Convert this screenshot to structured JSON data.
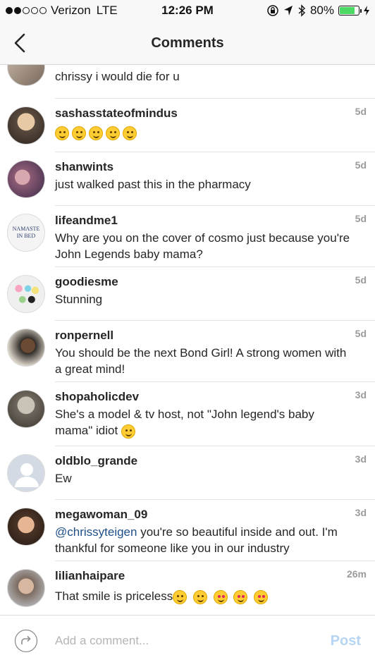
{
  "status_bar": {
    "carrier": "Verizon",
    "network": "LTE",
    "time": "12:26 PM",
    "battery": "80%",
    "battery_level": 0.8,
    "battery_color": "#4cd964"
  },
  "nav": {
    "title": "Comments",
    "back_icon": "chevron-left-icon"
  },
  "comments": [
    {
      "username": "",
      "text": "chrissy i would die for u",
      "time": ""
    },
    {
      "username": "sashasstateofmindus",
      "text": "",
      "emoji_count": 5,
      "time": "5d"
    },
    {
      "username": "shanwints",
      "text": "just walked past this in the pharmacy",
      "time": "5d"
    },
    {
      "username": "lifeandme1",
      "text": "Why are you on the cover of cosmo just because you're John Legends baby mama?",
      "time": "5d"
    },
    {
      "username": "goodiesme",
      "text": "Stunning",
      "time": "5d"
    },
    {
      "username": "ronpernell",
      "text": "You should be the next Bond Girl! A strong women with a great mind!",
      "time": "5d"
    },
    {
      "username": "shopaholicdev",
      "text": "She's a model & tv host, not \"John legend's baby mama\" idiot",
      "time": "3d"
    },
    {
      "username": "oldblo_grande",
      "text": "Ew",
      "time": "3d"
    },
    {
      "username": "megawoman_09",
      "mention": "@chrissyteigen",
      "text": " you're so beautiful inside and out. I'm thankful for someone like you in our industry",
      "time": "3d"
    },
    {
      "username": "lilianhaipare",
      "text": "That smile is priceless",
      "time": "26m"
    }
  ],
  "avatar_texts": {
    "lifeandme1_line1": "NAMASTE",
    "lifeandme1_line2": "IN BED"
  },
  "composer": {
    "placeholder": "Add a comment...",
    "post_label": "Post",
    "post_color": "#b6d5f2"
  }
}
